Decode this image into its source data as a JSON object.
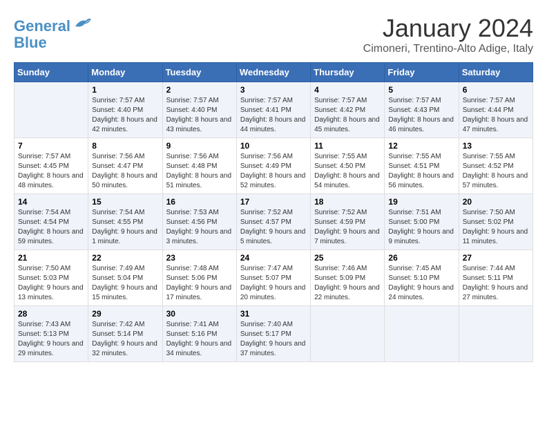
{
  "logo": {
    "line1": "General",
    "line2": "Blue"
  },
  "title": "January 2024",
  "subtitle": "Cimoneri, Trentino-Alto Adige, Italy",
  "days_header": [
    "Sunday",
    "Monday",
    "Tuesday",
    "Wednesday",
    "Thursday",
    "Friday",
    "Saturday"
  ],
  "weeks": [
    [
      {
        "day": "",
        "sunrise": "",
        "sunset": "",
        "daylight": ""
      },
      {
        "day": "1",
        "sunrise": "Sunrise: 7:57 AM",
        "sunset": "Sunset: 4:40 PM",
        "daylight": "Daylight: 8 hours and 42 minutes."
      },
      {
        "day": "2",
        "sunrise": "Sunrise: 7:57 AM",
        "sunset": "Sunset: 4:40 PM",
        "daylight": "Daylight: 8 hours and 43 minutes."
      },
      {
        "day": "3",
        "sunrise": "Sunrise: 7:57 AM",
        "sunset": "Sunset: 4:41 PM",
        "daylight": "Daylight: 8 hours and 44 minutes."
      },
      {
        "day": "4",
        "sunrise": "Sunrise: 7:57 AM",
        "sunset": "Sunset: 4:42 PM",
        "daylight": "Daylight: 8 hours and 45 minutes."
      },
      {
        "day": "5",
        "sunrise": "Sunrise: 7:57 AM",
        "sunset": "Sunset: 4:43 PM",
        "daylight": "Daylight: 8 hours and 46 minutes."
      },
      {
        "day": "6",
        "sunrise": "Sunrise: 7:57 AM",
        "sunset": "Sunset: 4:44 PM",
        "daylight": "Daylight: 8 hours and 47 minutes."
      }
    ],
    [
      {
        "day": "7",
        "sunrise": "Sunrise: 7:57 AM",
        "sunset": "Sunset: 4:45 PM",
        "daylight": "Daylight: 8 hours and 48 minutes."
      },
      {
        "day": "8",
        "sunrise": "Sunrise: 7:56 AM",
        "sunset": "Sunset: 4:47 PM",
        "daylight": "Daylight: 8 hours and 50 minutes."
      },
      {
        "day": "9",
        "sunrise": "Sunrise: 7:56 AM",
        "sunset": "Sunset: 4:48 PM",
        "daylight": "Daylight: 8 hours and 51 minutes."
      },
      {
        "day": "10",
        "sunrise": "Sunrise: 7:56 AM",
        "sunset": "Sunset: 4:49 PM",
        "daylight": "Daylight: 8 hours and 52 minutes."
      },
      {
        "day": "11",
        "sunrise": "Sunrise: 7:55 AM",
        "sunset": "Sunset: 4:50 PM",
        "daylight": "Daylight: 8 hours and 54 minutes."
      },
      {
        "day": "12",
        "sunrise": "Sunrise: 7:55 AM",
        "sunset": "Sunset: 4:51 PM",
        "daylight": "Daylight: 8 hours and 56 minutes."
      },
      {
        "day": "13",
        "sunrise": "Sunrise: 7:55 AM",
        "sunset": "Sunset: 4:52 PM",
        "daylight": "Daylight: 8 hours and 57 minutes."
      }
    ],
    [
      {
        "day": "14",
        "sunrise": "Sunrise: 7:54 AM",
        "sunset": "Sunset: 4:54 PM",
        "daylight": "Daylight: 8 hours and 59 minutes."
      },
      {
        "day": "15",
        "sunrise": "Sunrise: 7:54 AM",
        "sunset": "Sunset: 4:55 PM",
        "daylight": "Daylight: 9 hours and 1 minute."
      },
      {
        "day": "16",
        "sunrise": "Sunrise: 7:53 AM",
        "sunset": "Sunset: 4:56 PM",
        "daylight": "Daylight: 9 hours and 3 minutes."
      },
      {
        "day": "17",
        "sunrise": "Sunrise: 7:52 AM",
        "sunset": "Sunset: 4:57 PM",
        "daylight": "Daylight: 9 hours and 5 minutes."
      },
      {
        "day": "18",
        "sunrise": "Sunrise: 7:52 AM",
        "sunset": "Sunset: 4:59 PM",
        "daylight": "Daylight: 9 hours and 7 minutes."
      },
      {
        "day": "19",
        "sunrise": "Sunrise: 7:51 AM",
        "sunset": "Sunset: 5:00 PM",
        "daylight": "Daylight: 9 hours and 9 minutes."
      },
      {
        "day": "20",
        "sunrise": "Sunrise: 7:50 AM",
        "sunset": "Sunset: 5:02 PM",
        "daylight": "Daylight: 9 hours and 11 minutes."
      }
    ],
    [
      {
        "day": "21",
        "sunrise": "Sunrise: 7:50 AM",
        "sunset": "Sunset: 5:03 PM",
        "daylight": "Daylight: 9 hours and 13 minutes."
      },
      {
        "day": "22",
        "sunrise": "Sunrise: 7:49 AM",
        "sunset": "Sunset: 5:04 PM",
        "daylight": "Daylight: 9 hours and 15 minutes."
      },
      {
        "day": "23",
        "sunrise": "Sunrise: 7:48 AM",
        "sunset": "Sunset: 5:06 PM",
        "daylight": "Daylight: 9 hours and 17 minutes."
      },
      {
        "day": "24",
        "sunrise": "Sunrise: 7:47 AM",
        "sunset": "Sunset: 5:07 PM",
        "daylight": "Daylight: 9 hours and 20 minutes."
      },
      {
        "day": "25",
        "sunrise": "Sunrise: 7:46 AM",
        "sunset": "Sunset: 5:09 PM",
        "daylight": "Daylight: 9 hours and 22 minutes."
      },
      {
        "day": "26",
        "sunrise": "Sunrise: 7:45 AM",
        "sunset": "Sunset: 5:10 PM",
        "daylight": "Daylight: 9 hours and 24 minutes."
      },
      {
        "day": "27",
        "sunrise": "Sunrise: 7:44 AM",
        "sunset": "Sunset: 5:11 PM",
        "daylight": "Daylight: 9 hours and 27 minutes."
      }
    ],
    [
      {
        "day": "28",
        "sunrise": "Sunrise: 7:43 AM",
        "sunset": "Sunset: 5:13 PM",
        "daylight": "Daylight: 9 hours and 29 minutes."
      },
      {
        "day": "29",
        "sunrise": "Sunrise: 7:42 AM",
        "sunset": "Sunset: 5:14 PM",
        "daylight": "Daylight: 9 hours and 32 minutes."
      },
      {
        "day": "30",
        "sunrise": "Sunrise: 7:41 AM",
        "sunset": "Sunset: 5:16 PM",
        "daylight": "Daylight: 9 hours and 34 minutes."
      },
      {
        "day": "31",
        "sunrise": "Sunrise: 7:40 AM",
        "sunset": "Sunset: 5:17 PM",
        "daylight": "Daylight: 9 hours and 37 minutes."
      },
      {
        "day": "",
        "sunrise": "",
        "sunset": "",
        "daylight": ""
      },
      {
        "day": "",
        "sunrise": "",
        "sunset": "",
        "daylight": ""
      },
      {
        "day": "",
        "sunrise": "",
        "sunset": "",
        "daylight": ""
      }
    ]
  ]
}
